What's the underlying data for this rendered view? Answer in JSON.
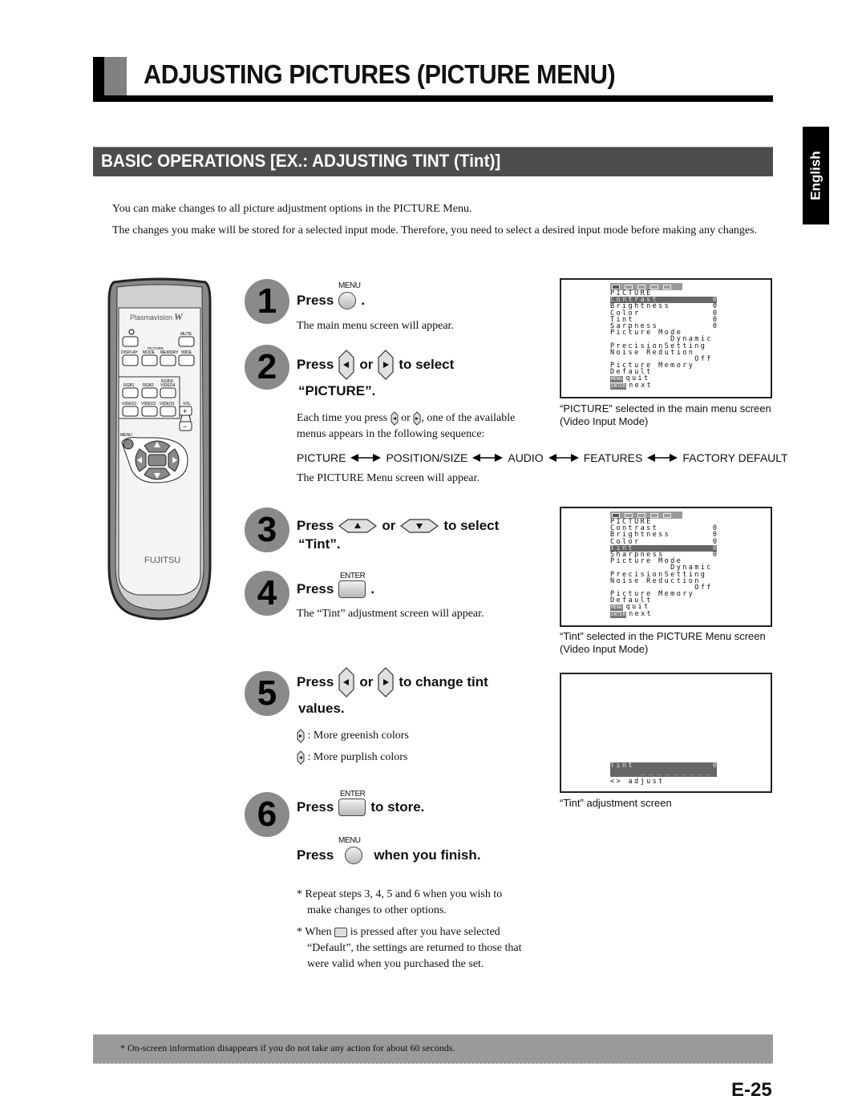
{
  "page": {
    "title": "ADJUSTING PICTURES (PICTURE MENU)",
    "section_title": "BASIC OPERATIONS [EX.: ADJUSTING TINT (Tint)]",
    "language_tab": "English",
    "intro": [
      "You can make changes to all picture adjustment options in the PICTURE Menu.",
      "The changes you make will be stored for a selected input mode.  Therefore, you need to select a desired input mode before making any changes."
    ],
    "page_number": "E-25",
    "footer_note": "* On-screen information disappears if you do not take any action for about 60 seconds."
  },
  "remote": {
    "brand_top": "Plasmavision",
    "brand_logo": "W",
    "brand_bottom": "FUJITSU",
    "buttons": {
      "power": "power-icon",
      "mute": "MUTE",
      "display": "DISPLAY",
      "picture_group": "PICTURE",
      "mode": "MODE",
      "memory": "MEMORY",
      "wide": "WIDE",
      "rgb1": "RGB1",
      "rgb2": "RGB2",
      "rgb3": "RGB3/ VIDEO4",
      "video1": "VIDEO1",
      "video2": "VIDEO2",
      "video3": "VIDEO3",
      "vol": "VOL",
      "vol_plus": "+",
      "vol_minus": "−",
      "menu": "MENU",
      "enter": "ENTER"
    }
  },
  "steps": [
    {
      "number": "1",
      "press": "Press",
      "button_label": "MENU",
      "after": ".",
      "desc": "The main menu screen will appear."
    },
    {
      "number": "2",
      "press": "Press",
      "or": "or",
      "after": "to select",
      "line2": "“PICTURE”.",
      "desc_a": "Each time you press",
      "desc_or": "or",
      "desc_b": ", one of the available menus appears in the following sequence:",
      "sequence": [
        "PICTURE",
        "POSITION/SIZE",
        "AUDIO",
        "FEATURES",
        "FACTORY DEFAULT"
      ],
      "desc2": "The PICTURE Menu screen will appear."
    },
    {
      "number": "3",
      "press": "Press",
      "or": "or",
      "after": "to select",
      "line2": "“Tint”."
    },
    {
      "number": "4",
      "press": "Press",
      "button_label": "ENTER",
      "after": ".",
      "desc": "The “Tint” adjustment screen will appear."
    },
    {
      "number": "5",
      "press": "Press",
      "or": "or",
      "after": "to change tint",
      "line2": "values.",
      "right_desc": ": More greenish colors",
      "left_desc": ": More purplish colors"
    },
    {
      "number": "6",
      "press": "Press",
      "button_label": "ENTER",
      "after": "to store.",
      "press2": "Press",
      "button2_label": "MENU",
      "after2": "when you finish."
    }
  ],
  "notes": [
    "* Repeat steps 3, 4, 5 and 6 when you wish to make changes to other options.",
    "* When",
    "is pressed after you have selected “Default”, the settings are returned to those that were valid when you purchased the set."
  ],
  "screens": [
    {
      "caption": "“PICTURE” selected in the main menu screen (Video Input Mode)",
      "heading": "PICTURE",
      "rows": [
        {
          "label": "Contrast",
          "value": "0",
          "selected": true
        },
        {
          "label": "Brightness",
          "value": "0"
        },
        {
          "label": "Color",
          "value": "0"
        },
        {
          "label": "Tint",
          "value": "0"
        },
        {
          "label": "Sarpness",
          "value": "0"
        },
        {
          "label": "Picture Mode",
          "value": ""
        },
        {
          "label": "          Dynamic",
          "value": ""
        },
        {
          "label": "PrecisionSetting",
          "value": ""
        },
        {
          "label": "Noise Redution",
          "value": ""
        },
        {
          "label": "              Off",
          "value": ""
        },
        {
          "label": "Picture Memory",
          "value": ""
        },
        {
          "label": "Default",
          "value": ""
        }
      ],
      "quit_tag": "MENU",
      "quit": "quit",
      "next_tag": "ENTER",
      "next": "next"
    },
    {
      "caption": "“Tint” selected in the PICTURE Menu screen (Video Input Mode)",
      "heading": "PICTURE",
      "rows": [
        {
          "label": "Contrast",
          "value": "0"
        },
        {
          "label": "Brightness",
          "value": "0"
        },
        {
          "label": "Color",
          "value": "0"
        },
        {
          "label": "Tint",
          "value": "0",
          "selected": true
        },
        {
          "label": "Sharpness",
          "value": "0"
        },
        {
          "label": "Picture Mode",
          "value": ""
        },
        {
          "label": "          Dynamic",
          "value": ""
        },
        {
          "label": "PrecisionSetting",
          "value": ""
        },
        {
          "label": "Noise Reduction",
          "value": ""
        },
        {
          "label": "              Off",
          "value": ""
        },
        {
          "label": "Picture Memory",
          "value": ""
        },
        {
          "label": "Default",
          "value": ""
        }
      ],
      "quit_tag": "MENU",
      "quit": "quit",
      "next_tag": "ENTER",
      "next": "next"
    },
    {
      "caption": "“Tint” adjustment screen",
      "label": "Tint",
      "value": "0",
      "bar": "_ _ _ _ _ _ _ _ _",
      "hint": "<> adjust"
    }
  ]
}
